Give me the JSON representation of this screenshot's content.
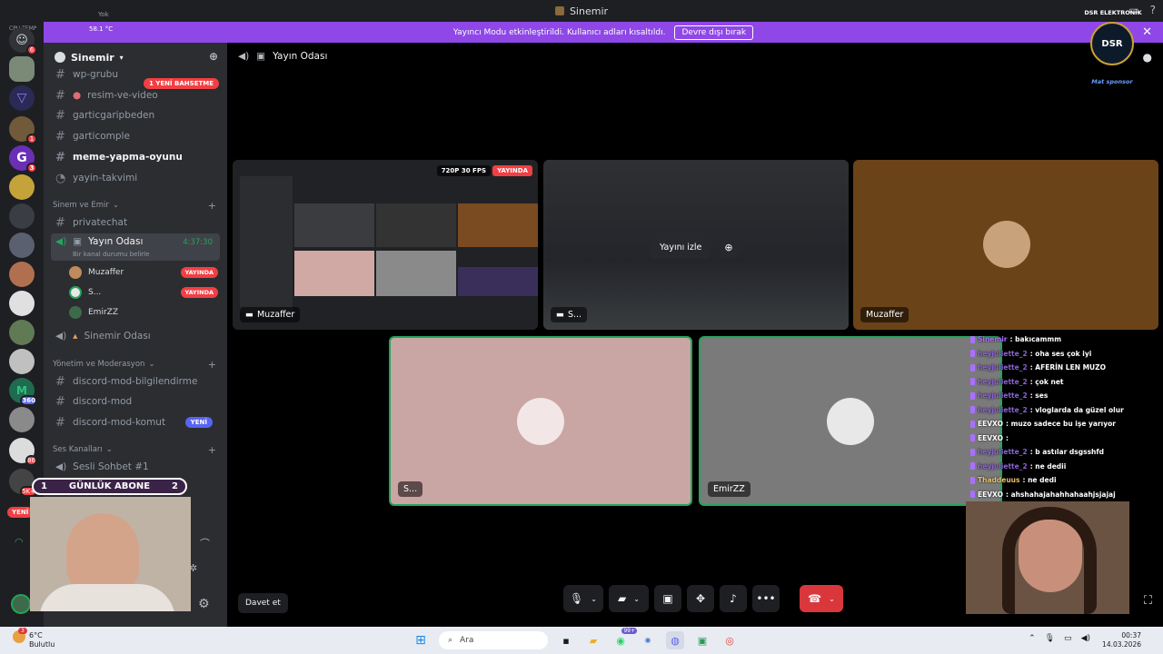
{
  "window": {
    "title": "Sinemir"
  },
  "notice": {
    "text": "Yayıncı Modu etkinleştirildi. Kullanıcı adları kısaltıldı.",
    "button": "Devre dışı bırak"
  },
  "rail_overlay": {
    "label_top": "Yok",
    "temp": "58.1 °C",
    "cpu": "CPU TEMP"
  },
  "rail_badges": [
    "6",
    "1",
    "1",
    "3",
    "360",
    "86",
    "5K+",
    "YENİ"
  ],
  "server": {
    "name": "Sinemir"
  },
  "channels": {
    "wp": "wp-grubu",
    "mention_pill": "1 YENİ BAHSETME",
    "resim": "resim-ve-video",
    "c1": "garticgaripbeden",
    "c2": "garticomple",
    "c3": "meme-yapma-oyunu",
    "c4": "yayin-takvimi",
    "cat1": "Sinem ve Emir",
    "c5": "privatechat",
    "voice_active": "Yayın Odası",
    "voice_timer": "4:37:30",
    "voice_status": "Bir kanal durumu belirle",
    "u1": "Muzaffer",
    "u2": "S...",
    "u3": "EmirZZ",
    "live_label": "YAYINDA",
    "voice2": "Sinemir Odası",
    "cat2": "Yönetim ve Moderasyon",
    "c6": "discord-mod-bilgilendirme",
    "c7": "discord-mod",
    "c8": "discord-mod-komut",
    "new_badge": "YENİ",
    "cat3": "Ses Kanalları",
    "voice3": "Sesli Sohbet #1"
  },
  "call": {
    "title": "Yayın Odası",
    "tile1_label": "Muzaffer",
    "tile1_fps": "720P 30 FPS",
    "tile1_live": "YAYINDA",
    "tile2_label": "S...",
    "tile2_watch": "Yayını izle",
    "tile3_label": "Muzaffer",
    "tile4_label": "S...",
    "tile5_label": "EmirZZ",
    "invite": "Davet et"
  },
  "sub_banner": {
    "left": "1",
    "text": "GÜNLÜK ABONE",
    "right": "2"
  },
  "logo": {
    "top": "DSR ELEKTRONİK",
    "mid": "DSR",
    "bottom": "Mat sponsor"
  },
  "chat": [
    {
      "user": "Sinemir",
      "msg": ": bakıcammm",
      "color": "#a970ff"
    },
    {
      "user": "heyjuliette_2",
      "msg": ": oha ses çok iyi",
      "color": "#8a63d2"
    },
    {
      "user": "heyjuliette_2",
      "msg": ": AFERİN LEN MUZO",
      "color": "#8a63d2"
    },
    {
      "user": "heyjuliette_2",
      "msg": ": çok net",
      "color": "#8a63d2"
    },
    {
      "user": "heyjuliette_2",
      "msg": ": ses",
      "color": "#8a63d2"
    },
    {
      "user": "heyjuliette_2",
      "msg": ": vloglarda da güzel olur",
      "color": "#8a63d2"
    },
    {
      "user": "EEVXO",
      "msg": ": muzo sadece bu işe yarıyor",
      "color": "#ffffff"
    },
    {
      "user": "EEVXO",
      "msg": ":",
      "color": "#ffffff"
    },
    {
      "user": "heyjuliette_2",
      "msg": ": b astılar dsgsshfd",
      "color": "#8a63d2"
    },
    {
      "user": "heyjuliette_2",
      "msg": ": ne dedii",
      "color": "#8a63d2"
    },
    {
      "user": "Thaddeuus",
      "msg": ": ne dedi",
      "color": "#e8c06a"
    },
    {
      "user": "EEVXO",
      "msg": ": ahshahajahahhahaahjsjajaj",
      "color": "#ffffff"
    }
  ],
  "taskbar": {
    "weather_badge": "3",
    "temp": "6°C",
    "cond": "Bulutlu",
    "search": "Ara",
    "badge99": "99+",
    "time": "00:37",
    "date": "14.03.2026"
  }
}
